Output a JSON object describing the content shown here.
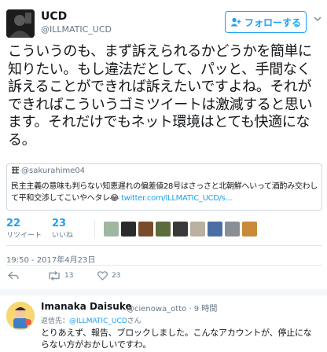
{
  "author": {
    "name": "UCD",
    "handle": "@ILLMATIC_UCD"
  },
  "follow_label": "フォローする",
  "tweet_text": "こういうのも、まず訴えられるかどうかを簡単に知りたい。もし違法だとして、パッと、手間なく訴えることができれば訴えたいですよね。それができればこういうゴミツイートは激減すると思います。それだけでもネット環境はとても快適になる。",
  "quote": {
    "handle": "@sakurahime04",
    "text": "民主主義の意味も判らない知恵遅れの偏差値28号はさっさと北朝鮮へいって酒酌み交わして平和交渉してこいやヘタレ😂",
    "link": "twitter.com/ILLMATIC_UCD/s..."
  },
  "stats": {
    "retweets": "22",
    "retweets_label": "リツイート",
    "likes": "23",
    "likes_label": "いいね"
  },
  "liker_avatar_colors": [
    "#9fb7a0",
    "#2b2b2b",
    "#7a4b2a",
    "#5d6b3d",
    "#3a3a3a",
    "#b9b0a0",
    "#4a6fa5",
    "#8a8f96",
    "#c98a3a"
  ],
  "timestamp": "19:50 - 2017年4月23日",
  "actions": {
    "retweet_count": "13",
    "like_count": "23"
  },
  "reply": {
    "name": "Imanaka Daisuke",
    "handle": "@cienowa_otto · 9 時間",
    "to_prefix": "返信先：",
    "to_handle": "@ILLMATIC_UCD",
    "to_suffix": "さん",
    "text": "とりあえず、報告、ブロックしました。こんなアカウントが、停止にならない方がおかしいですわ。"
  },
  "colors": {
    "accent": "#1da1f2",
    "muted": "#657786",
    "border": "#e1e8ed"
  }
}
